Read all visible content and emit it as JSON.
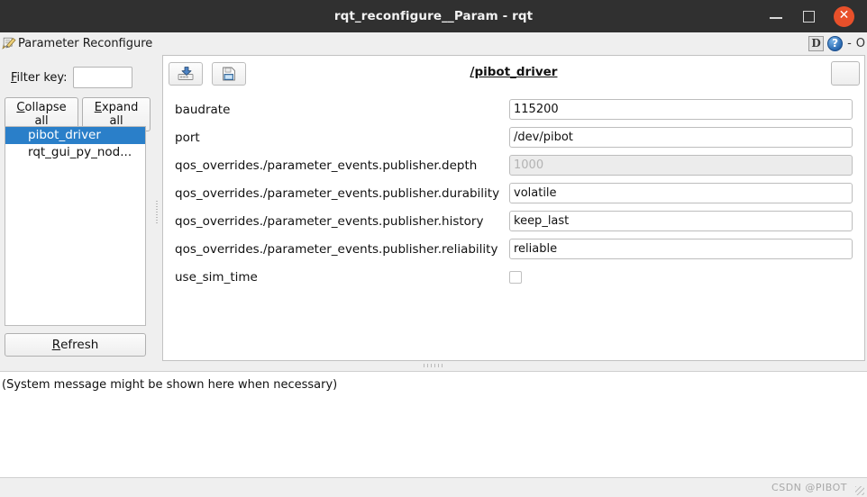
{
  "window": {
    "title": "rqt_reconfigure__Param - rqt",
    "controls": {
      "minimize": "minimize-icon",
      "maximize": "maximize-icon",
      "close": "✕"
    }
  },
  "dock": {
    "icon": "edit-pencil-icon",
    "title": "Parameter Reconfigure",
    "float_button": "D",
    "help_button": "?",
    "dash": "-",
    "extra": "O"
  },
  "sidebar": {
    "filter": {
      "label_prefix": "F",
      "label_rest": "ilter key:",
      "value": "",
      "placeholder": ""
    },
    "collapse_button": {
      "accel": "C",
      "rest": "ollapse all"
    },
    "expand_button": {
      "accel": "E",
      "rest": "xpand all"
    },
    "nodes": [
      {
        "label": "pibot_driver",
        "selected": true
      },
      {
        "label": "rqt_gui_py_nod...",
        "selected": false
      }
    ],
    "refresh_button": {
      "accel": "R",
      "rest": "efresh"
    }
  },
  "param_panel": {
    "toolbar": {
      "load_icon": "load-parameters-icon",
      "save_icon": "save-parameters-icon",
      "corner_icon": ""
    },
    "node_title": "/pibot_driver",
    "parameters": [
      {
        "name": "baudrate",
        "value": "115200",
        "type": "text",
        "readonly": false
      },
      {
        "name": "port",
        "value": "/dev/pibot",
        "type": "text",
        "readonly": false
      },
      {
        "name": "qos_overrides./parameter_events.publisher.depth",
        "value": "1000",
        "type": "text",
        "readonly": true
      },
      {
        "name": "qos_overrides./parameter_events.publisher.durability",
        "value": "volatile",
        "type": "text",
        "readonly": false
      },
      {
        "name": "qos_overrides./parameter_events.publisher.history",
        "value": "keep_last",
        "type": "text",
        "readonly": false
      },
      {
        "name": "qos_overrides./parameter_events.publisher.reliability",
        "value": "reliable",
        "type": "text",
        "readonly": false
      },
      {
        "name": "use_sim_time",
        "value": "",
        "type": "checkbox",
        "readonly": false,
        "checked": false
      }
    ]
  },
  "system_message": "(System message might be shown here when necessary)",
  "statusbar": {
    "watermark": "CSDN @PIBOT"
  },
  "colors": {
    "titlebar_bg": "#303030",
    "close_button": "#e8502a",
    "selection": "#2a7fc9",
    "panel_bg": "#efefef",
    "readonly_field": "#ececec"
  }
}
